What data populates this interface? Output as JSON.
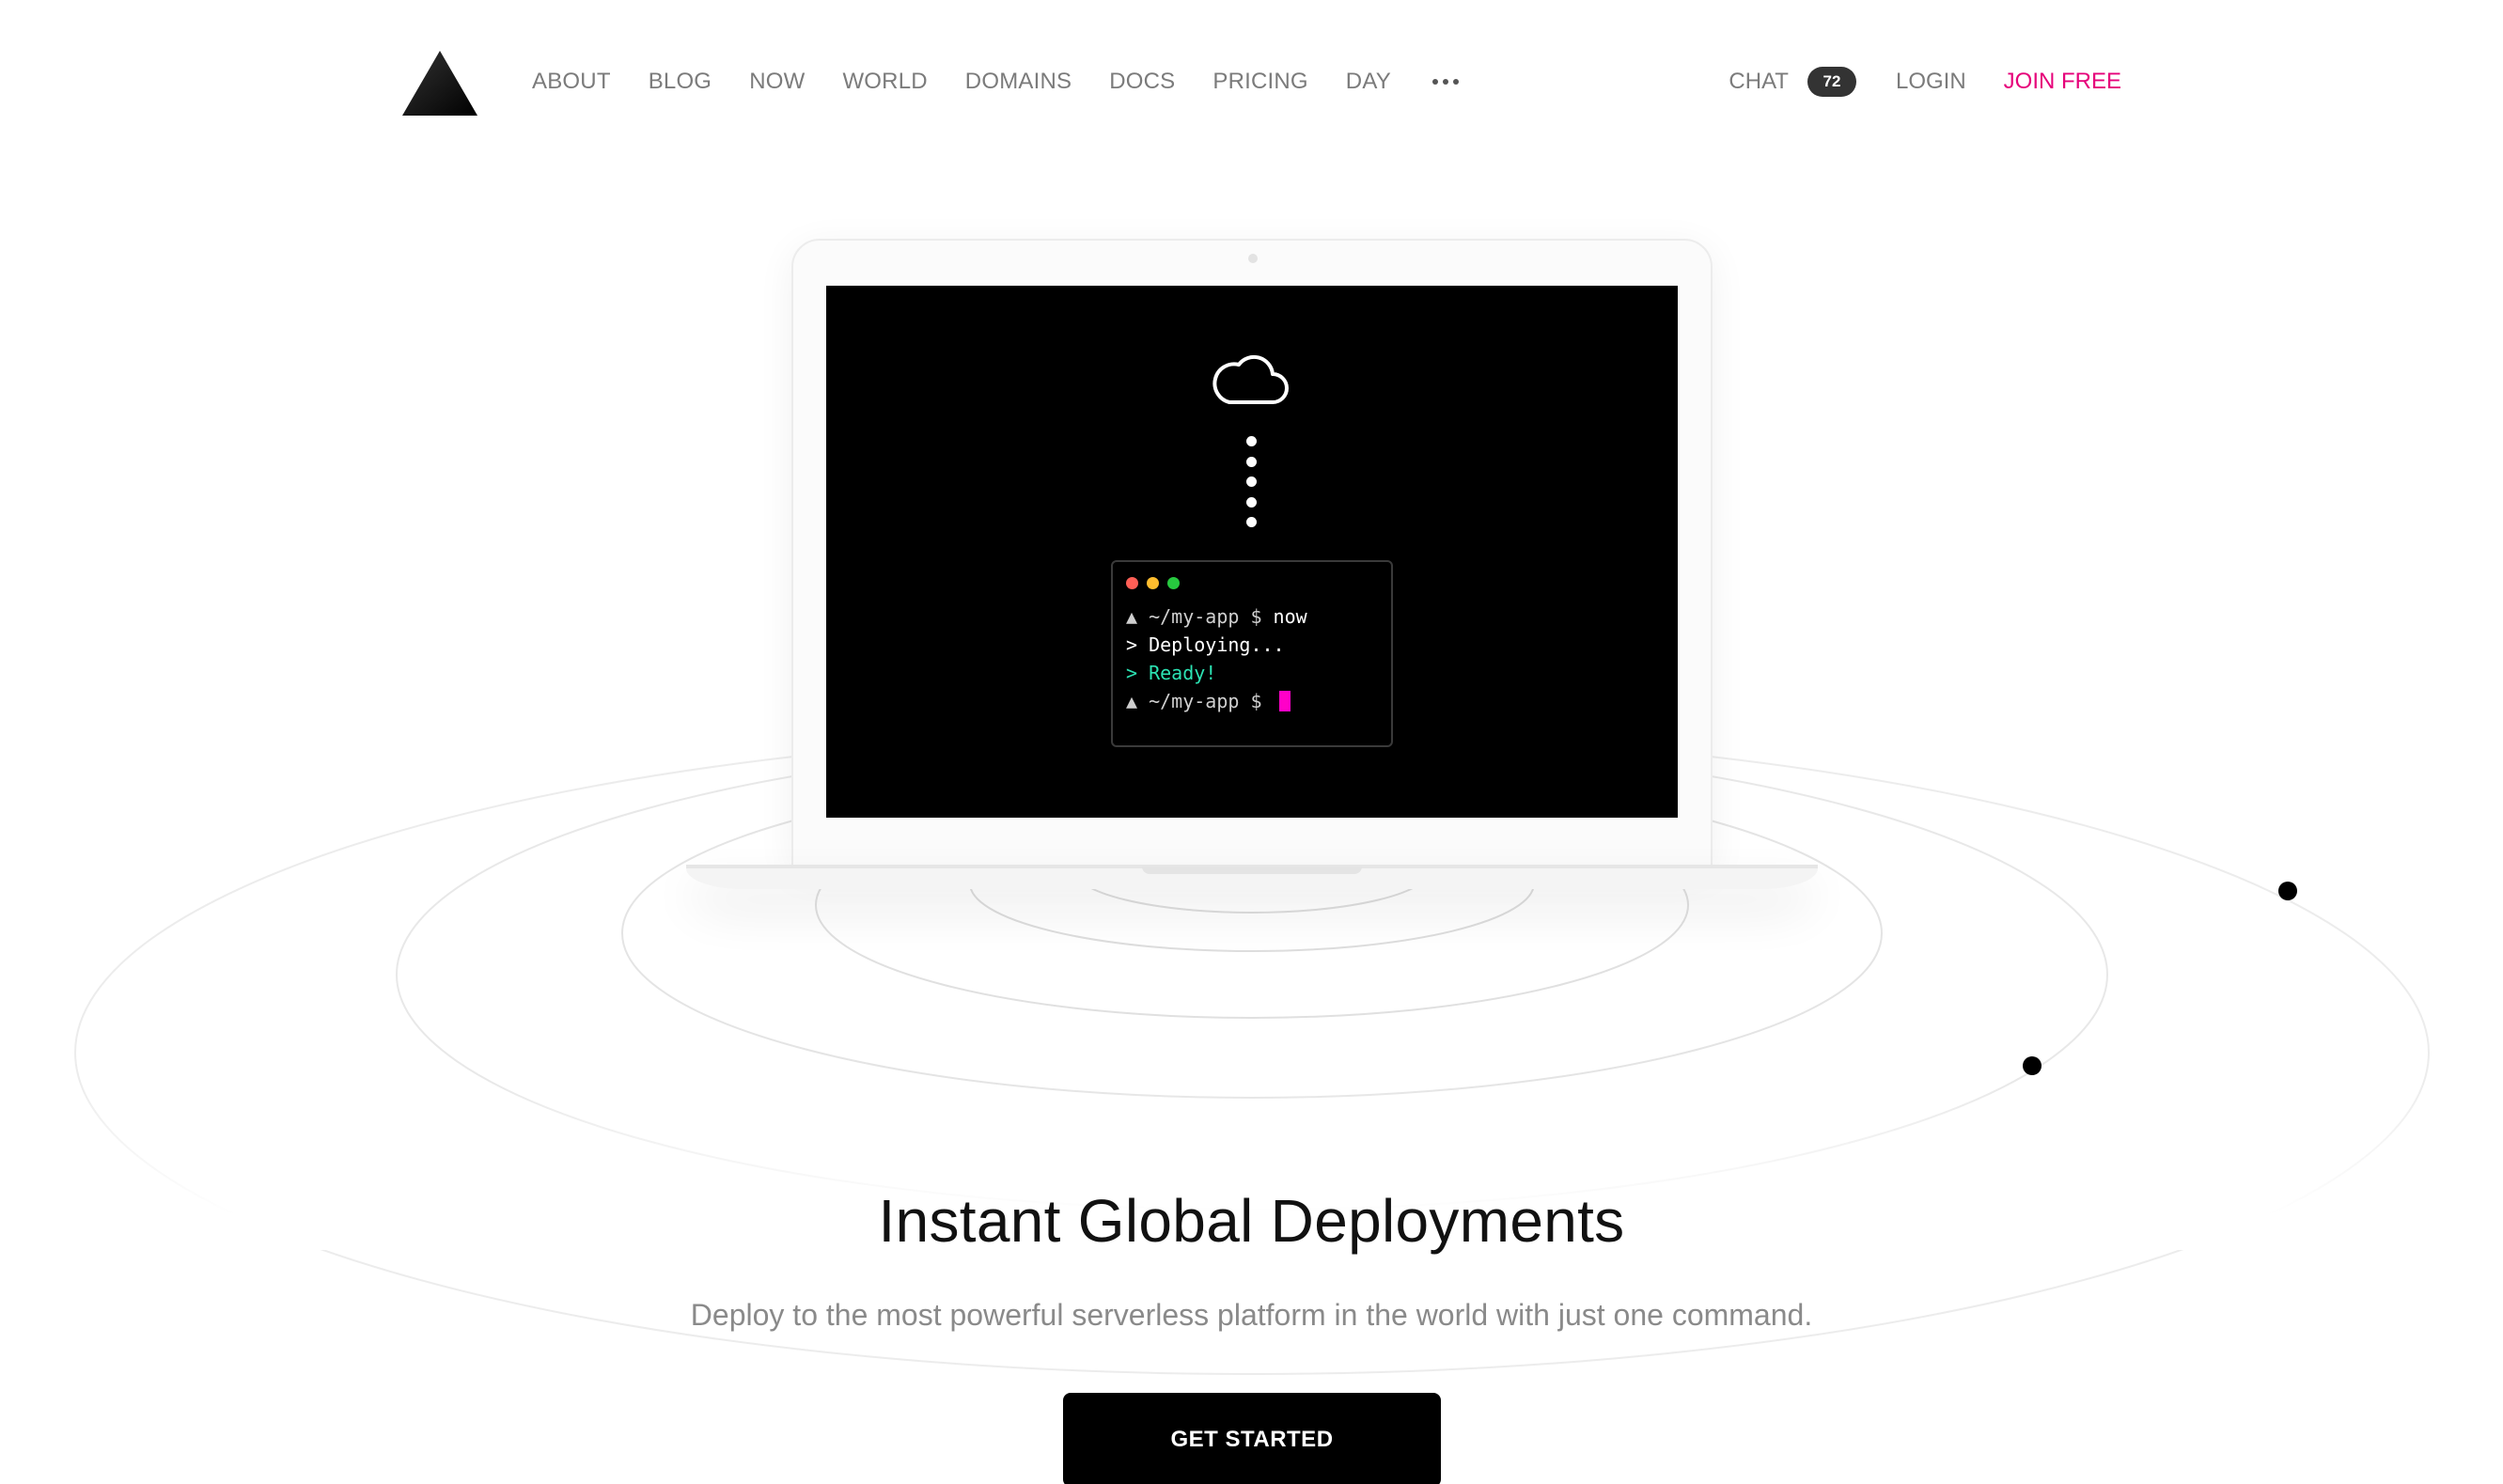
{
  "nav": {
    "links": [
      "ABOUT",
      "BLOG",
      "NOW",
      "WORLD",
      "DOMAINS",
      "DOCS",
      "PRICING",
      "DAY"
    ],
    "more_icon": "ellipsis-icon",
    "chat_label": "CHAT",
    "chat_count": "72",
    "login_label": "LOGIN",
    "join_label": "JOIN FREE"
  },
  "terminal": {
    "line1_prompt": "▲ ~/my-app $ ",
    "line1_cmd": "now",
    "line2": "> Deploying...",
    "line3": "> Ready!",
    "line4_prompt": "▲ ~/my-app $ "
  },
  "hero": {
    "headline": "Instant Global Deployments",
    "subline": "Deploy to the most powerful serverless platform in the world with just one command.",
    "cta_label": "GET STARTED"
  },
  "colors": {
    "accent": "#e6007a",
    "cursor": "#ff00c8",
    "ready": "#2ce3b3",
    "light_red": "#ff5f56",
    "light_yellow": "#ffbd2e",
    "light_green": "#27c93f"
  },
  "icons": [
    "logo-triangle-icon",
    "ellipsis-icon",
    "cloud-icon"
  ]
}
